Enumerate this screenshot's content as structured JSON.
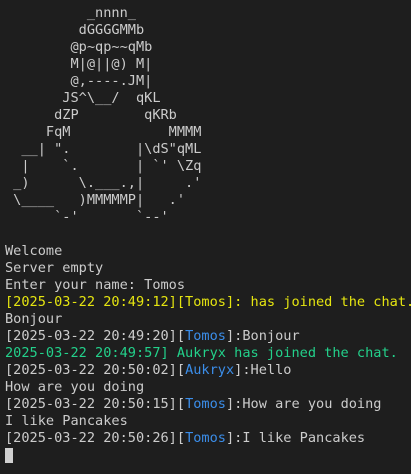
{
  "colors": {
    "background": "#1e1e1e",
    "foreground": "#cccccc",
    "timestamp": "#cccccc",
    "name": "#3b8eea",
    "system_yellow": "#e5e510",
    "system_green": "#23d18b"
  },
  "ascii_art": [
    "          _nnnn_",
    "         dGGGGMMb",
    "        @p~qp~~qMb",
    "        M|@||@) M|",
    "        @,----.JM|",
    "       JS^\\__/  qKL",
    "      dZP        qKRb",
    "     FqM            MMMM",
    "  __| \".        |\\dS\"qML",
    "  |    `.       | `' \\Zq",
    " _)      \\.___.,|     .'",
    " \\____   )MMMMMP|   .'",
    "      `-'       `--'"
  ],
  "messages": [
    {
      "kind": "plain",
      "text": "Welcome"
    },
    {
      "kind": "plain",
      "text": "Server empty"
    },
    {
      "kind": "plain",
      "text": "Enter your name: Tomos"
    },
    {
      "kind": "join_yellow",
      "text": "[2025-03-22 20:49:12][Tomos]: has joined the chat."
    },
    {
      "kind": "plain",
      "text": "Bonjour"
    },
    {
      "kind": "chat",
      "timestamp": "[2025-03-22 20:49:20]",
      "lb": "[",
      "name": "Tomos",
      "rb": "]",
      "text": ":Bonjour"
    },
    {
      "kind": "join_green",
      "text": "2025-03-22 20:49:57] Aukryx has joined the chat."
    },
    {
      "kind": "chat",
      "timestamp": "[2025-03-22 20:50:02]",
      "lb": "[",
      "name": "Aukryx",
      "rb": "]",
      "text": ":Hello"
    },
    {
      "kind": "plain",
      "text": "How are you doing"
    },
    {
      "kind": "chat",
      "timestamp": "[2025-03-22 20:50:15]",
      "lb": "[",
      "name": "Tomos",
      "rb": "]",
      "text": ":How are you doing"
    },
    {
      "kind": "plain",
      "text": "I like Pancakes"
    },
    {
      "kind": "chat",
      "timestamp": "[2025-03-22 20:50:26]",
      "lb": "[",
      "name": "Tomos",
      "rb": "]",
      "text": ":I like Pancakes"
    }
  ]
}
